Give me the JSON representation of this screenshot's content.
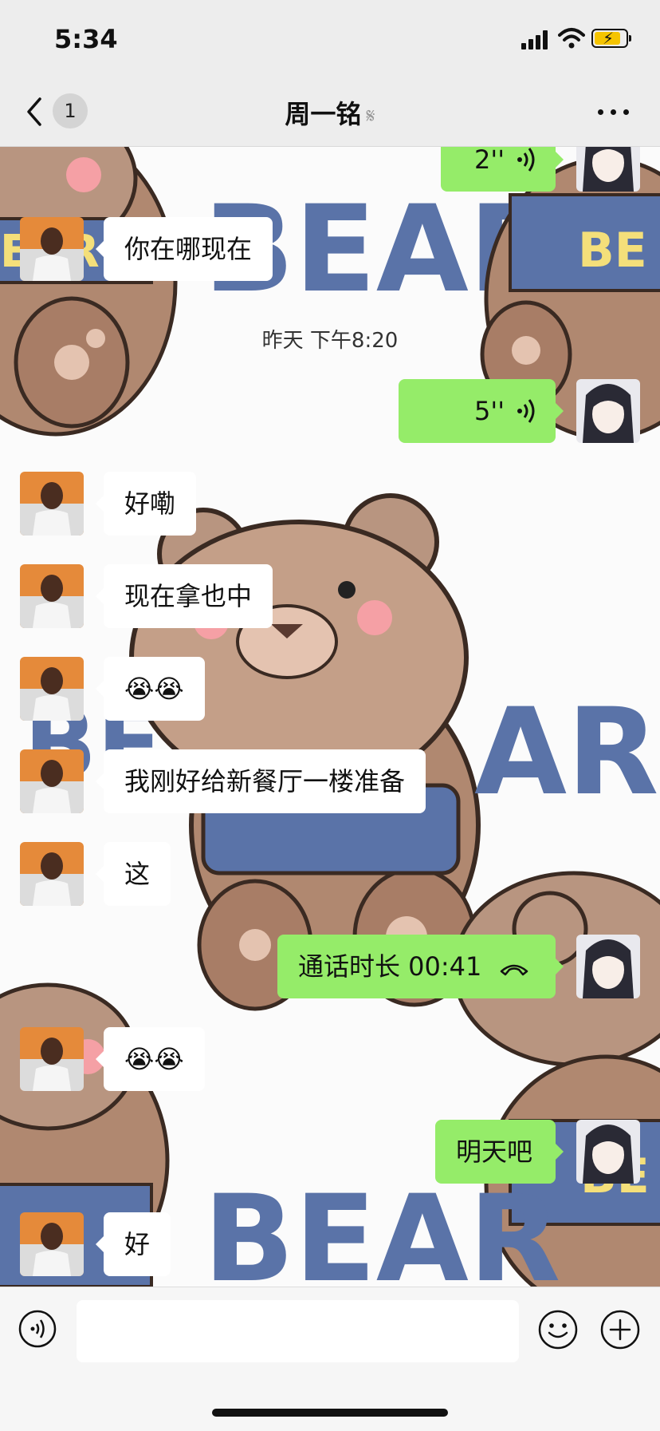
{
  "status_bar": {
    "time": "5:34"
  },
  "nav": {
    "back_badge": "1",
    "title": "周一铭"
  },
  "messages": {
    "voice_top": "2''",
    "m1": "你在哪现在",
    "timestamp": "昨天 下午8:20",
    "voice_5": "5''",
    "m2": "好嘞",
    "m3": "现在拿也中",
    "m4": "😭😭",
    "m5": "我刚好给新餐厅一楼准备",
    "m6": "这",
    "call": "通话时长 00:41",
    "m7": "😭😭",
    "m8": "明天吧",
    "m9": "好"
  },
  "wallpaper": {
    "text": "BEAR"
  },
  "input": {
    "value": ""
  },
  "colors": {
    "sent_bubble": "#95ec69",
    "received_bubble": "#ffffff",
    "bear_brown": "#b08870",
    "bear_text_blue": "#5a73a8"
  },
  "icons": {
    "back": "chevron-left-icon",
    "ear": "ear-icon",
    "more": "more-dots-icon",
    "voice_msg": "sound-wave-icon",
    "call": "phone-hangup-icon",
    "input_voice": "voice-input-icon",
    "emoji": "emoji-icon",
    "plus": "plus-icon"
  }
}
